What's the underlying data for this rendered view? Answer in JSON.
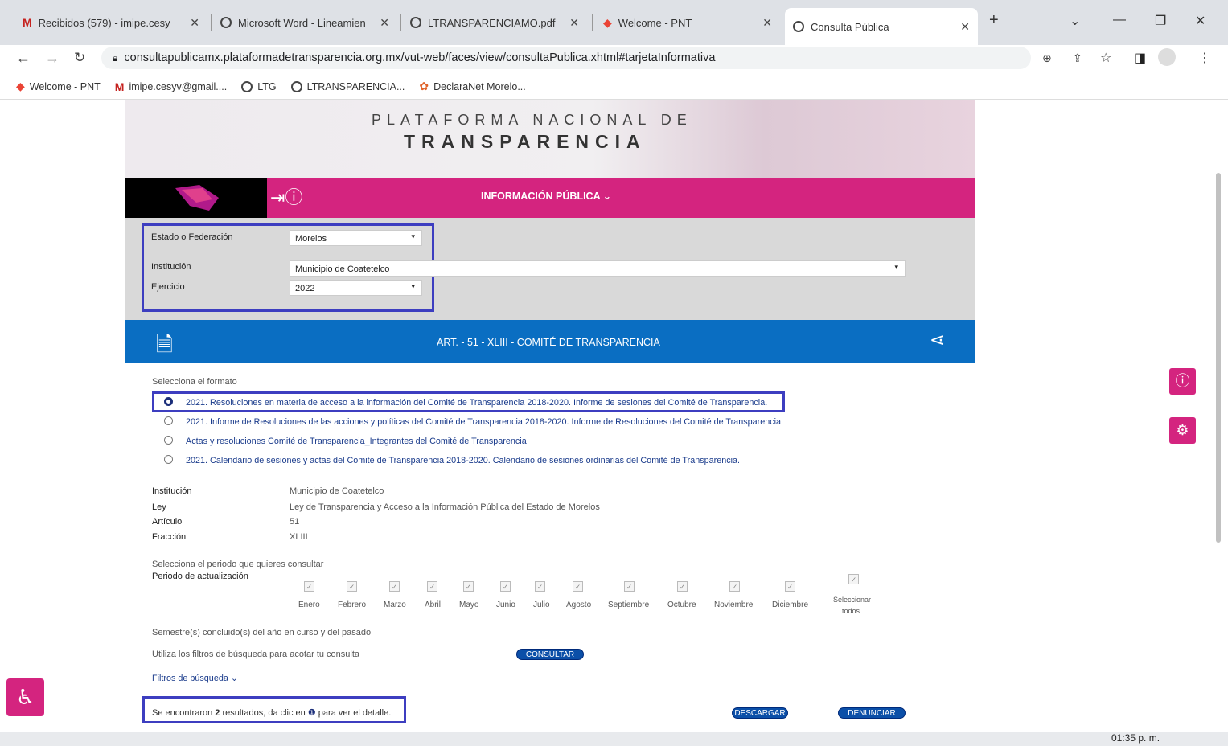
{
  "browser": {
    "tabs": [
      {
        "label": "Recibidos (579) - imipe.cesy"
      },
      {
        "label": "Microsoft Word - Lineamien"
      },
      {
        "label": "LTRANSPARENCIAMO.pdf"
      },
      {
        "label": "Welcome - PNT"
      },
      {
        "label": "Consulta Pública"
      }
    ],
    "url": "consultapublicamx.plataformadetransparencia.org.mx/vut-web/faces/view/consultaPublica.xhtml#tarjetaInformativa",
    "bookmarks": [
      {
        "label": "Welcome - PNT"
      },
      {
        "label": "imipe.cesyv@gmail...."
      },
      {
        "label": "LTG"
      },
      {
        "label": "LTRANSPARENCIA..."
      },
      {
        "label": "DeclaraNet Morelo..."
      }
    ]
  },
  "header": {
    "line1": "PLATAFORMA NACIONAL DE",
    "line2": "TRANSPARENCIA"
  },
  "nav": {
    "title": "INFORMACIÓN PÚBLICA"
  },
  "filters": {
    "estado_label": "Estado o Federación",
    "estado_value": "Morelos",
    "institucion_label": "Institución",
    "institucion_value": "Municipio de Coatetelco",
    "ejercicio_label": "Ejercicio",
    "ejercicio_value": "2022"
  },
  "section": {
    "title": "ART. - 51 - XLIII - COMITÉ DE TRANSPARENCIA"
  },
  "formato": {
    "label": "Selecciona el formato",
    "options": [
      {
        "label": "2021. Resoluciones en materia de acceso a la información del Comité de Transparencia 2018-2020. Informe de sesiones del Comité de Transparencia.",
        "selected": true
      },
      {
        "label": "2021. Informe de Resoluciones de las acciones y políticas del Comité de Transparencia 2018-2020. Informe de Resoluciones del Comité de Transparencia.",
        "selected": false
      },
      {
        "label": "Actas y resoluciones Comité de Transparencia_Integrantes del Comité de Transparencia",
        "selected": false
      },
      {
        "label": "2021. Calendario de sesiones y actas del Comité de Transparencia 2018-2020. Calendario de sesiones ordinarias del Comité de Transparencia.",
        "selected": false
      }
    ]
  },
  "details": {
    "institucion_label": "Institución",
    "institucion_value": "Municipio de Coatetelco",
    "ley_label": "Ley",
    "ley_value": "Ley de Transparencia y Acceso a la Información Pública del Estado de Morelos",
    "articulo_label": "Artículo",
    "articulo_value": "51",
    "fraccion_label": "Fracción",
    "fraccion_value": "XLIII"
  },
  "periodo": {
    "label": "Selecciona el periodo que quieres consultar",
    "sub_label": "Periodo de actualización",
    "months": [
      "Enero",
      "Febrero",
      "Marzo",
      "Abril",
      "Mayo",
      "Junio",
      "Julio",
      "Agosto",
      "Septiembre",
      "Octubre",
      "Noviembre",
      "Diciembre"
    ],
    "select_all_1": "Seleccionar",
    "select_all_2": "todos"
  },
  "semestre": "Semestre(s) concluido(s) del año en curso y del pasado",
  "filtros_hint": "Utiliza los filtros de búsqueda para acotar tu consulta",
  "consultar": "CONSULTAR",
  "filtros_link": "Filtros de búsqueda",
  "results": {
    "pre": "Se encontraron ",
    "count": "2",
    "mid": " resultados, da clic en ",
    "post": " para ver el detalle."
  },
  "descargar": "DESCARGAR",
  "denunciar": "DENUNCIAR",
  "clock": "01:35 p. m."
}
